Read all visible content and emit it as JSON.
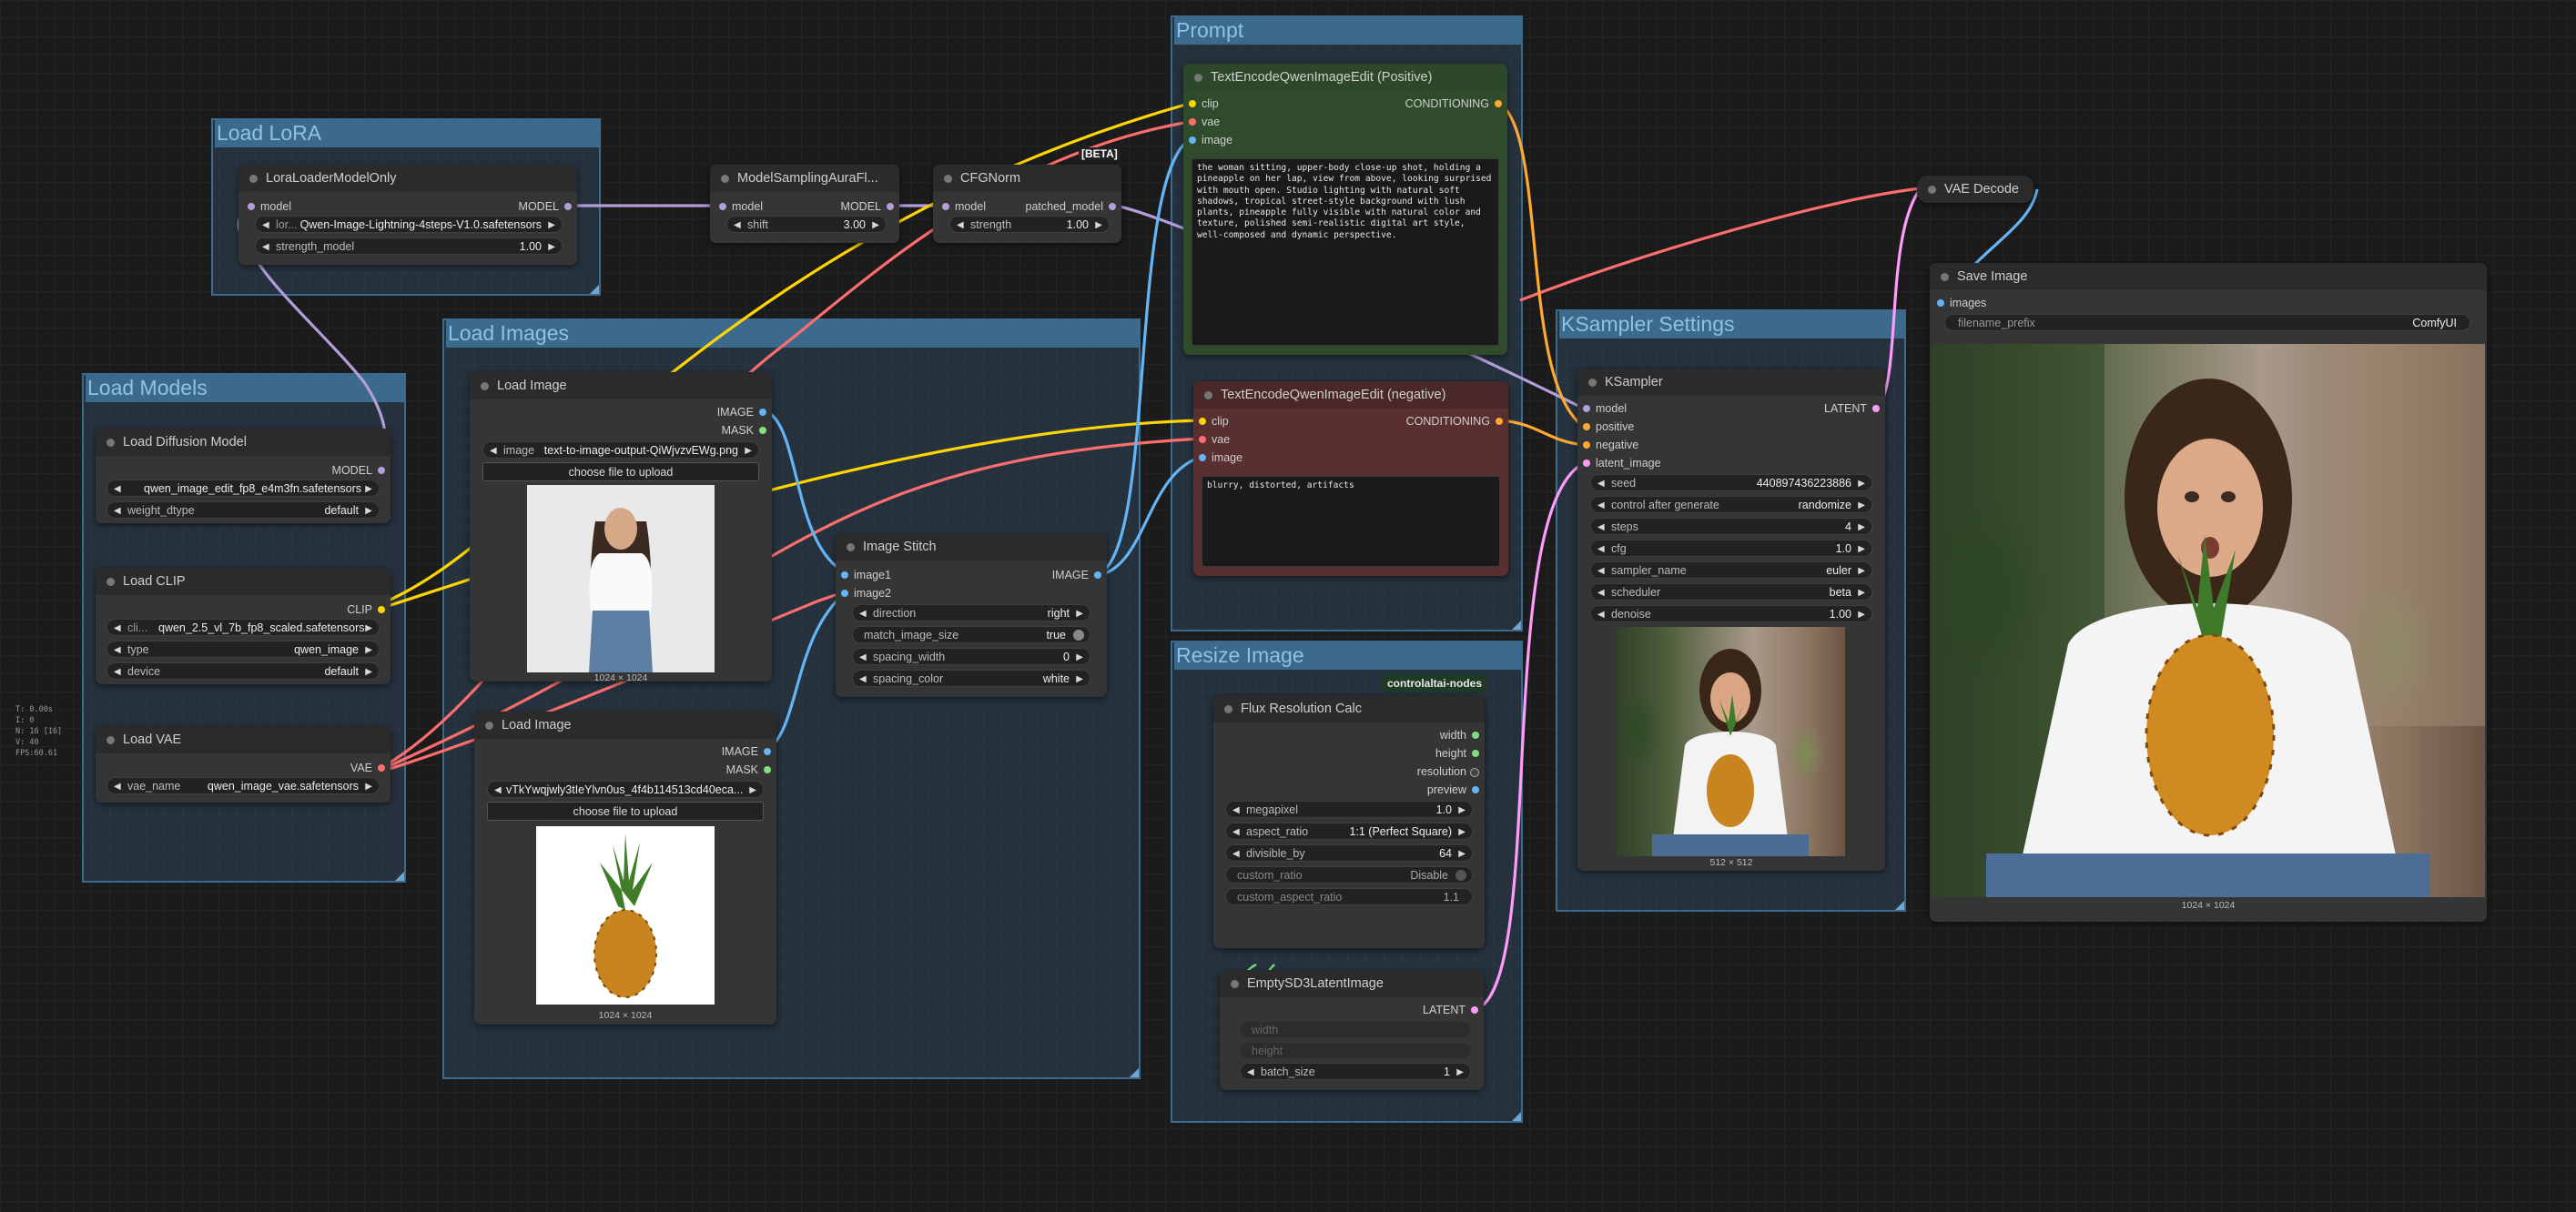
{
  "groups": {
    "load_lora": "Load LoRA",
    "load_models": "Load Models",
    "load_images": "Load Images",
    "prompt": "Prompt",
    "resize_image": "Resize Image",
    "ksampler_settings": "KSampler Settings"
  },
  "nodes": {
    "lora": {
      "title": "LoraLoaderModelOnly",
      "in_model": "model",
      "out_model": "MODEL",
      "lora_label": "lor...",
      "lora_value": "Qwen-Image-Lightning-4steps-V1.0.safetensors",
      "strength_label": "strength_model",
      "strength_value": "1.00"
    },
    "model_sampling": {
      "title": "ModelSamplingAuraFl...",
      "in_model": "model",
      "out_model": "MODEL",
      "shift_label": "shift",
      "shift_value": "3.00"
    },
    "cfgnorm": {
      "title": "CFGNorm",
      "badge": "[BETA]",
      "in_model": "model",
      "out_model": "patched_model",
      "strength_label": "strength",
      "strength_value": "1.00"
    },
    "diffusion": {
      "title": "Load Diffusion Model",
      "out_model": "MODEL",
      "unet_value": "qwen_image_edit_fp8_e4m3fn.safetensors",
      "dtype_label": "weight_dtype",
      "dtype_value": "default"
    },
    "clip": {
      "title": "Load CLIP",
      "out_clip": "CLIP",
      "clip_label": "cli...",
      "clip_value": "qwen_2.5_vl_7b_fp8_scaled.safetensors",
      "type_label": "type",
      "type_value": "qwen_image",
      "device_label": "device",
      "device_value": "default"
    },
    "vae": {
      "title": "Load VAE",
      "out_vae": "VAE",
      "vae_label": "vae_name",
      "vae_value": "qwen_image_vae.safetensors"
    },
    "load_image_1": {
      "title": "Load Image",
      "out_image": "IMAGE",
      "out_mask": "MASK",
      "image_label": "image",
      "image_value": "text-to-image-output-QiWjvzvEWg.png",
      "upload": "choose file to upload",
      "dims": "1024 × 1024"
    },
    "load_image_2": {
      "title": "Load Image",
      "out_image": "IMAGE",
      "out_mask": "MASK",
      "image_value": "vTkYwqjwly3tIeYlvn0us_4f4b114513cd40eca...",
      "upload": "choose file to upload",
      "dims": "1024 × 1024"
    },
    "stitch": {
      "title": "Image Stitch",
      "in_image1": "image1",
      "in_image2": "image2",
      "out_image": "IMAGE",
      "direction_label": "direction",
      "direction_value": "right",
      "match_label": "match_image_size",
      "match_value": "true",
      "spacing_width_label": "spacing_width",
      "spacing_width_value": "0",
      "spacing_color_label": "spacing_color",
      "spacing_color_value": "white"
    },
    "pos": {
      "title": "TextEncodeQwenImageEdit (Positive)",
      "in_clip": "clip",
      "in_vae": "vae",
      "in_image": "image",
      "out": "CONDITIONING",
      "text": "the woman sitting, upper-body close-up shot, holding a pineapple on her lap, view from above, looking surprised with mouth open. Studio lighting with natural soft shadows, tropical street-style background with lush plants, pineapple fully visible with natural color and texture, polished semi-realistic digital art style, well-composed and dynamic perspective."
    },
    "neg": {
      "title": "TextEncodeQwenImageEdit (negative)",
      "in_clip": "clip",
      "in_vae": "vae",
      "in_image": "image",
      "out": "CONDITIONING",
      "text": "blurry, distorted, artifacts"
    },
    "flux_calc": {
      "title": "Flux Resolution Calc",
      "badge": "controlaltai-nodes",
      "out_width": "width",
      "out_height": "height",
      "out_resolution": "resolution",
      "out_preview": "preview",
      "megapixel_label": "megapixel",
      "megapixel_value": "1.0",
      "aspect_label": "aspect_ratio",
      "aspect_value": "1:1 (Perfect Square)",
      "divisible_label": "divisible_by",
      "divisible_value": "64",
      "custom_ratio_label": "custom_ratio",
      "custom_ratio_value": "Disable",
      "custom_aspect_label": "custom_aspect_ratio",
      "custom_aspect_value": "1.1"
    },
    "latent": {
      "title": "EmptySD3LatentImage",
      "out": "LATENT",
      "width_label": "width",
      "height_label": "height",
      "batch_label": "batch_size",
      "batch_value": "1"
    },
    "ksampler": {
      "title": "KSampler",
      "in_model": "model",
      "in_positive": "positive",
      "in_negative": "negative",
      "in_latent": "latent_image",
      "out": "LATENT",
      "seed_label": "seed",
      "seed_value": "440897436223886",
      "control_label": "control after generate",
      "control_value": "randomize",
      "steps_label": "steps",
      "steps_value": "4",
      "cfg_label": "cfg",
      "cfg_value": "1.0",
      "sampler_label": "sampler_name",
      "sampler_value": "euler",
      "scheduler_label": "scheduler",
      "scheduler_value": "beta",
      "denoise_label": "denoise",
      "denoise_value": "1.00",
      "preview_dims": "512 × 512"
    },
    "vae_decode": {
      "title": "VAE Decode"
    },
    "save": {
      "title": "Save Image",
      "in_images": "images",
      "prefix_label": "filename_prefix",
      "prefix_value": "ComfyUI",
      "dims": "1024 × 1024"
    }
  },
  "stats": "T: 0.00s\nI: 0\nN: 16 [16]\nV: 40\nFPS:60.61",
  "colors": {
    "model_wire": "#b39ddb",
    "clip_wire": "#ffd500",
    "vae_wire": "#ff6e6e",
    "image_wire": "#64b5f6",
    "conditioning_wire": "#ffa931",
    "latent_wire": "#ff9cf9",
    "int_port": "#7fe07f"
  }
}
